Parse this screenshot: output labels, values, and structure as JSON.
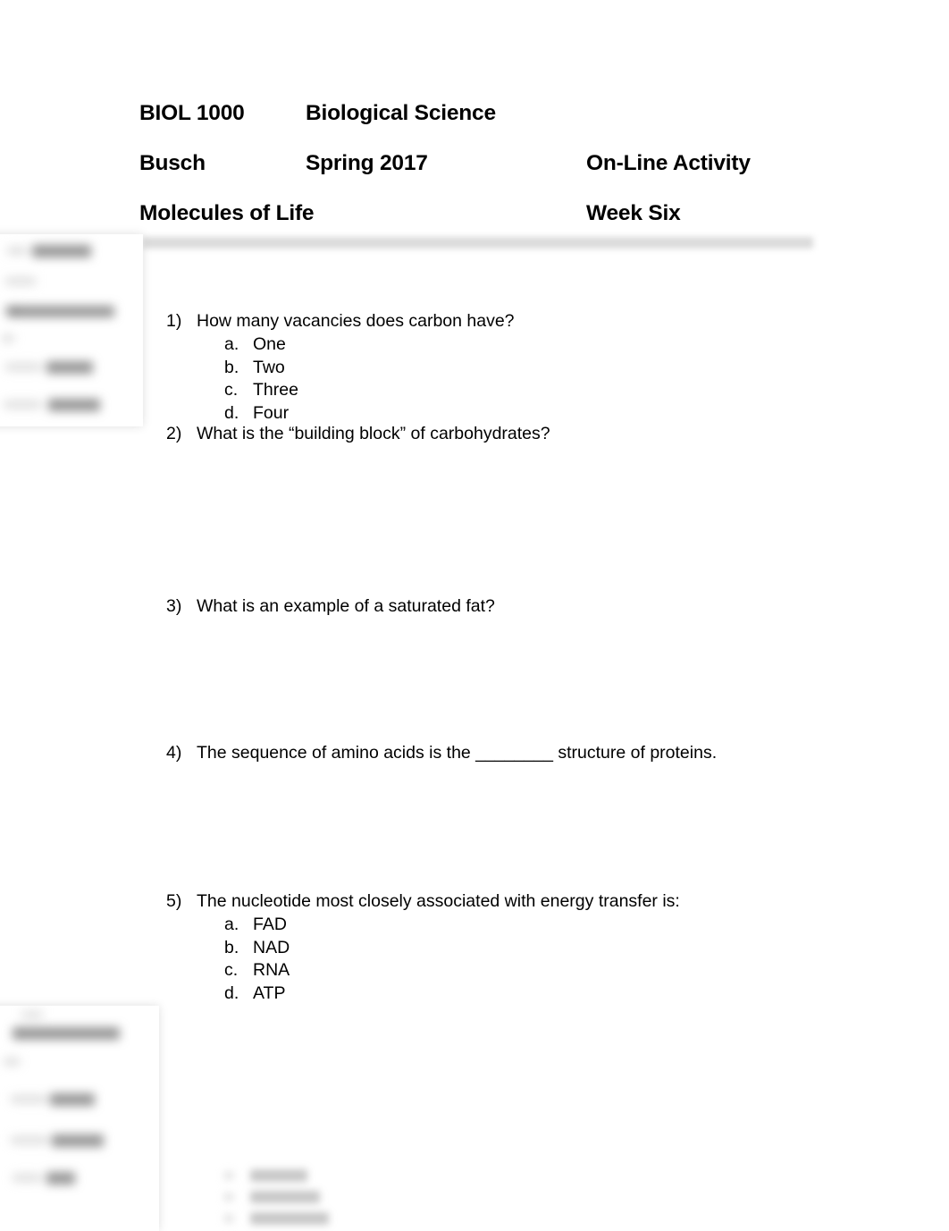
{
  "document": {
    "header": {
      "row1": {
        "course_code": "BIOL 1000",
        "course_name": "Biological Science",
        "right": ""
      },
      "row2": {
        "instructor": "Busch",
        "term": "Spring 2017",
        "activity": "On-Line Activity"
      },
      "row3": {
        "topic": "Molecules of Life",
        "week": "Week Six"
      }
    },
    "questions": [
      {
        "number": "1)",
        "text": "How many vacancies does carbon have?",
        "options": [
          {
            "letter": "a.",
            "text": "One"
          },
          {
            "letter": "b.",
            "text": "Two"
          },
          {
            "letter": "c.",
            "text": "Three"
          },
          {
            "letter": "d.",
            "text": "Four"
          }
        ]
      },
      {
        "number": "2)",
        "text": "What is the “building block” of carbohydrates?",
        "options": []
      },
      {
        "number": "3)",
        "text": "What is an example of a saturated fat?",
        "options": []
      },
      {
        "number": "4)",
        "text": "The sequence of amino acids is the ________ structure of proteins.",
        "options": []
      },
      {
        "number": "5)",
        "text": "The nucleotide most closely associated with energy transfer is:",
        "options": [
          {
            "letter": "a.",
            "text": "FAD"
          },
          {
            "letter": "b.",
            "text": "NAD"
          },
          {
            "letter": "c.",
            "text": "RNA"
          },
          {
            "letter": "d.",
            "text": "ATP"
          }
        ]
      }
    ]
  },
  "overlays": {
    "top_panel": {
      "name": "blurred-preview-panel-top"
    },
    "bottom_panel": {
      "name": "blurred-preview-panel-bottom"
    },
    "bottom_stub": {
      "name": "blurred-option-list"
    }
  },
  "colors": {
    "page_background": "#ffffff",
    "text": "#000000",
    "header_rule": "#d9d9d9"
  }
}
